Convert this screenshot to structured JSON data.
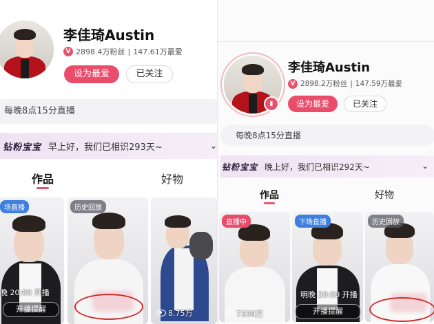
{
  "left": {
    "profile": {
      "name": "李佳琦Austin",
      "fans": "2898.4万粉丝",
      "favs": "147.61万最爱",
      "separator": "|",
      "fav_button": "设为最爱",
      "follow_button": "已关注"
    },
    "schedule": "每晚8点15分直播",
    "fanbar": {
      "brand": "钻粉宝宝",
      "greeting": "早上好，我们已相识293天~"
    },
    "tabs": [
      "作品",
      "好物"
    ],
    "cards": [
      {
        "tag": "场直播",
        "overlay": "晚  20:00 开播",
        "remind": "开播提醒"
      },
      {
        "tag": "历史回放"
      },
      {
        "views": "8.75万"
      }
    ]
  },
  "right": {
    "profile": {
      "name": "李佳琦Austin",
      "fans": "2898.2万粉丝",
      "favs": "147.59万最爱",
      "separator": "|",
      "fav_button": "设为最爱",
      "follow_button": "已关注"
    },
    "schedule": "每晚8点15分直播",
    "fanbar": {
      "brand": "钻粉宝宝",
      "greeting": "晚上好，我们已相识292天~"
    },
    "tabs": [
      "作品",
      "好物"
    ],
    "cards": [
      {
        "tag": "直播中",
        "views": "7330万"
      },
      {
        "tag": "下场直播",
        "overlay": "明晚 20:00 开播",
        "remind": "开播提醒"
      },
      {
        "tag": "历史回放"
      }
    ]
  },
  "colors": {
    "accent": "#ea4c6c",
    "tag_blue": "#3f7fe0",
    "fanbar": "#efe3f3",
    "annotation": "#d62a2a"
  },
  "icons": [
    "verified-v-icon",
    "chevron-down-icon",
    "eye-icon",
    "live-bars-icon"
  ]
}
